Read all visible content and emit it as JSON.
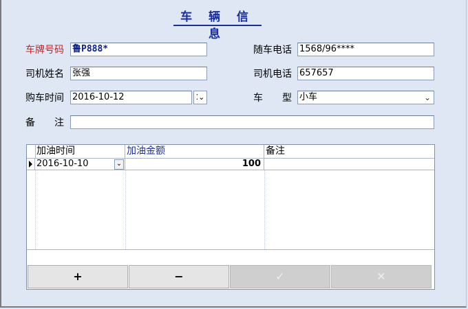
{
  "title": "车 辆 信 息",
  "form": {
    "plate_label": "车牌号码",
    "plate_value": "鲁P888*",
    "phone_label": "随车电话",
    "phone_value": "1568/96****",
    "driver_label": "司机姓名",
    "driver_value": "张强",
    "driver_phone_label": "司机电话",
    "driver_phone_value": "657657",
    "purchase_label": "购车时间",
    "purchase_value": "2016-10-12",
    "type_label": "车　　型",
    "type_value": "小车",
    "note_label": "备　　注",
    "note_value": ""
  },
  "grid": {
    "columns": [
      "加油时间",
      "加油金额",
      "备注"
    ],
    "rows": [
      {
        "time": "2016-10-10",
        "amount": "100",
        "note": ""
      }
    ]
  },
  "buttons": {
    "add": "+",
    "remove": "−",
    "confirm": "✓",
    "cancel": "✕"
  },
  "colors": {
    "background": "#dfe7f4",
    "title": "#1a2f9e",
    "required_label": "#d02020",
    "header_highlight": "#1a2f9e"
  }
}
